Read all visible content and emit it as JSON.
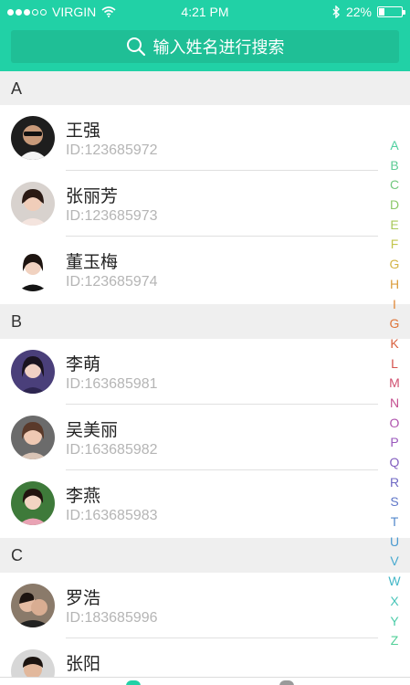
{
  "status_bar": {
    "carrier": "VIRGIN",
    "time": "4:21 PM",
    "battery": "22%"
  },
  "search": {
    "placeholder": "输入姓名进行搜索"
  },
  "sections": [
    {
      "letter": "A",
      "contacts": [
        {
          "name": "王强",
          "id": "ID:123685972"
        },
        {
          "name": "张丽芳",
          "id": "ID:123685973"
        },
        {
          "name": "董玉梅",
          "id": "ID:123685974"
        }
      ]
    },
    {
      "letter": "B",
      "contacts": [
        {
          "name": "李萌",
          "id": "ID:163685981"
        },
        {
          "name": "吴美丽",
          "id": "ID:163685982"
        },
        {
          "name": "李燕",
          "id": "ID:163685983"
        }
      ]
    },
    {
      "letter": "C",
      "contacts": [
        {
          "name": "罗浩",
          "id": "ID:183685996"
        },
        {
          "name": "张阳",
          "id": ""
        }
      ]
    }
  ],
  "index_letters": [
    "A",
    "B",
    "C",
    "D",
    "E",
    "F",
    "G",
    "H",
    "I",
    "G",
    "K",
    "L",
    "M",
    "N",
    "O",
    "P",
    "Q",
    "R",
    "S",
    "T",
    "U",
    "V",
    "W",
    "X",
    "Y",
    "Z"
  ],
  "colors": {
    "accent": "#21d1a6",
    "search_bg": "#1fbf96",
    "section_bg": "#efefef"
  }
}
